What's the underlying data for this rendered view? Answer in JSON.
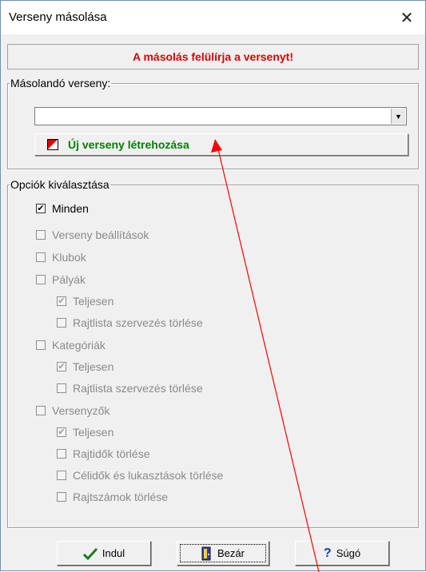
{
  "window": {
    "title": "Verseny másolása",
    "close_glyph": "✕"
  },
  "warning_text": "A másolás felülírja a versenyt!",
  "copy_group": {
    "legend": "Másolandó verseny:",
    "combo_value": "",
    "combo_arrow": "▼",
    "new_button_label": "Új verseny létrehozása",
    "new_button_icon": "new-document-icon"
  },
  "options_group": {
    "legend": "Opciók kiválasztása",
    "items": [
      {
        "label": "Minden",
        "checked": true,
        "enabled": true
      },
      {
        "label": "Verseny beállítások",
        "checked": false,
        "enabled": false
      },
      {
        "label": "Klubok",
        "checked": false,
        "enabled": false
      },
      {
        "label": "Pályák",
        "checked": false,
        "enabled": false
      },
      {
        "label": "Teljesen",
        "checked": true,
        "enabled": false
      },
      {
        "label": "Rajtlista szervezés törlése",
        "checked": false,
        "enabled": false
      },
      {
        "label": "Kategóriák",
        "checked": false,
        "enabled": false
      },
      {
        "label": "Teljesen",
        "checked": true,
        "enabled": false
      },
      {
        "label": "Rajtlista szervezés törlése",
        "checked": false,
        "enabled": false
      },
      {
        "label": "Versenyzők",
        "checked": false,
        "enabled": false
      },
      {
        "label": "Teljesen",
        "checked": true,
        "enabled": false
      },
      {
        "label": "Rajtidők törlése",
        "checked": false,
        "enabled": false
      },
      {
        "label": "Célidők és lukasztások törlése",
        "checked": false,
        "enabled": false
      },
      {
        "label": "Rajtszámok törlése",
        "checked": false,
        "enabled": false
      }
    ]
  },
  "buttons": {
    "start": {
      "label": "Indul",
      "icon": "checkmark-icon"
    },
    "close": {
      "label": "Bezár",
      "icon": "door-icon"
    },
    "help": {
      "label": "Súgó",
      "icon": "question-icon"
    }
  },
  "colors": {
    "warning": "#e00000",
    "new_button_text": "#008000",
    "annotation_arrow": "#ff0000"
  }
}
